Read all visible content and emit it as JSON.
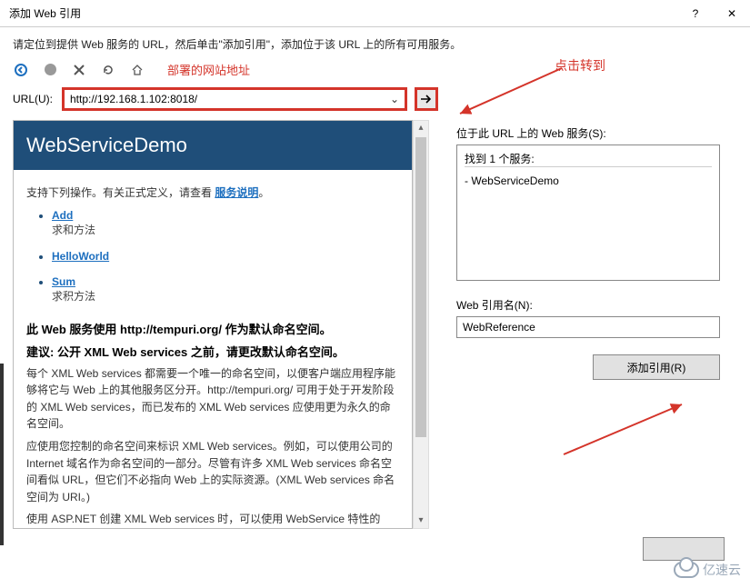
{
  "window": {
    "title": "添加 Web 引用",
    "help": "?",
    "close": "✕"
  },
  "instruction": "请定位到提供 Web 服务的 URL，然后单击\"添加引用\"，添加位于该 URL 上的所有可用服务。",
  "annotations": {
    "deploy_address": "部署的网站地址",
    "click_go": "点击转到"
  },
  "url": {
    "label": "URL(U):",
    "value": "http://192.168.1.102:8018/",
    "go_icon": "→"
  },
  "preview": {
    "header": "WebServiceDemo",
    "support_prefix": "支持下列操作。有关正式定义，请查看",
    "service_desc_link": "服务说明",
    "support_suffix": "。",
    "ops": [
      {
        "name": "Add",
        "desc": "求和方法"
      },
      {
        "name": "HelloWorld",
        "desc": ""
      },
      {
        "name": "Sum",
        "desc": "求积方法"
      }
    ],
    "h1": "此 Web 服务使用 http://tempuri.org/ 作为默认命名空间。",
    "h2": "建议: 公开 XML Web services 之前，请更改默认命名空间。",
    "p1": "每个 XML Web services 都需要一个唯一的命名空间，以便客户端应用程序能够将它与 Web 上的其他服务区分开。http://tempuri.org/ 可用于处于开发阶段的 XML Web services，而已发布的 XML Web services 应使用更为永久的命名空间。",
    "p2": "应使用您控制的命名空间来标识 XML Web services。例如，可以使用公司的 Internet 域名作为命名空间的一部分。尽管有许多 XML Web services 命名空间看似 URL，但它们不必指向 Web 上的实际资源。(XML Web services 命名空间为 URI。)",
    "p3": "使用 ASP.NET 创建 XML Web services 时，可以使用 WebService 特性的 Namespace 属性更改默认命名空间。WebService 特性适用于包含 XML Web services 方法的类。下面的代码实例将命名空间设置为 \"http://microsoft.com/webservices/\":"
  },
  "right": {
    "services_label": "位于此 URL 上的 Web 服务(S):",
    "found": "找到 1 个服务:",
    "item": "- WebServiceDemo",
    "ref_label": "Web 引用名(N):",
    "ref_value": "WebReference",
    "add_btn": "添加引用(R)"
  },
  "watermark": "亿速云"
}
